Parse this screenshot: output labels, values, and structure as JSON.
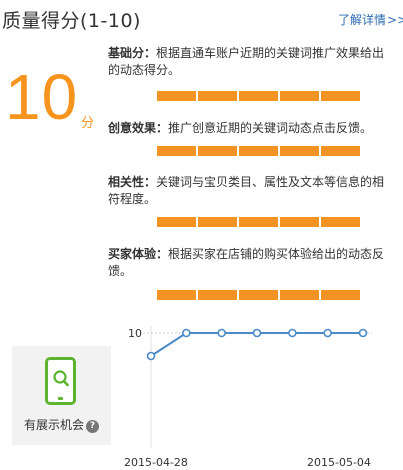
{
  "header": {
    "title": "质量得分(1-10)",
    "detail_link": "了解详情",
    "detail_chevron": ">>"
  },
  "score": {
    "value": "10",
    "unit": "分"
  },
  "metrics": [
    {
      "label": "基础分：",
      "desc": "根据直通车账户近期的关键词推广效果给出的动态得分。",
      "level": 5,
      "max": 5
    },
    {
      "label": "创意效果：",
      "desc": "推广创意近期的关键词动态点击反馈。",
      "level": 5,
      "max": 5
    },
    {
      "label": "相关性：",
      "desc": "关键词与宝贝类目、属性及文本等信息的相符程度。",
      "level": 5,
      "max": 5
    },
    {
      "label": "买家体验：",
      "desc": "根据买家在店铺的购买体验给出的动态反馈。",
      "level": 5,
      "max": 5
    }
  ],
  "device_card": {
    "icon": "mobile-search-icon",
    "label": "有展示机会",
    "help": "?",
    "accent": "#5cb531"
  },
  "colors": {
    "accent": "#f7941d",
    "bar": "#f29323",
    "link": "#2b6bb5",
    "line": "#4a8ac7"
  },
  "chart_data": {
    "type": "line",
    "x": [
      "2015-04-28",
      "",
      "",
      "",
      "",
      "",
      "2015-05-04"
    ],
    "x_tick_labels": [
      "2015-04-28",
      "2015-05-04"
    ],
    "series": [
      {
        "values": [
          9.8,
          10,
          10,
          10,
          10,
          10,
          10
        ]
      }
    ],
    "y_tick_labels": [
      "10"
    ],
    "ylim": [
      9,
      10
    ],
    "grid": "dashed reference line at 10",
    "title": "",
    "xlabel": "",
    "ylabel": ""
  }
}
